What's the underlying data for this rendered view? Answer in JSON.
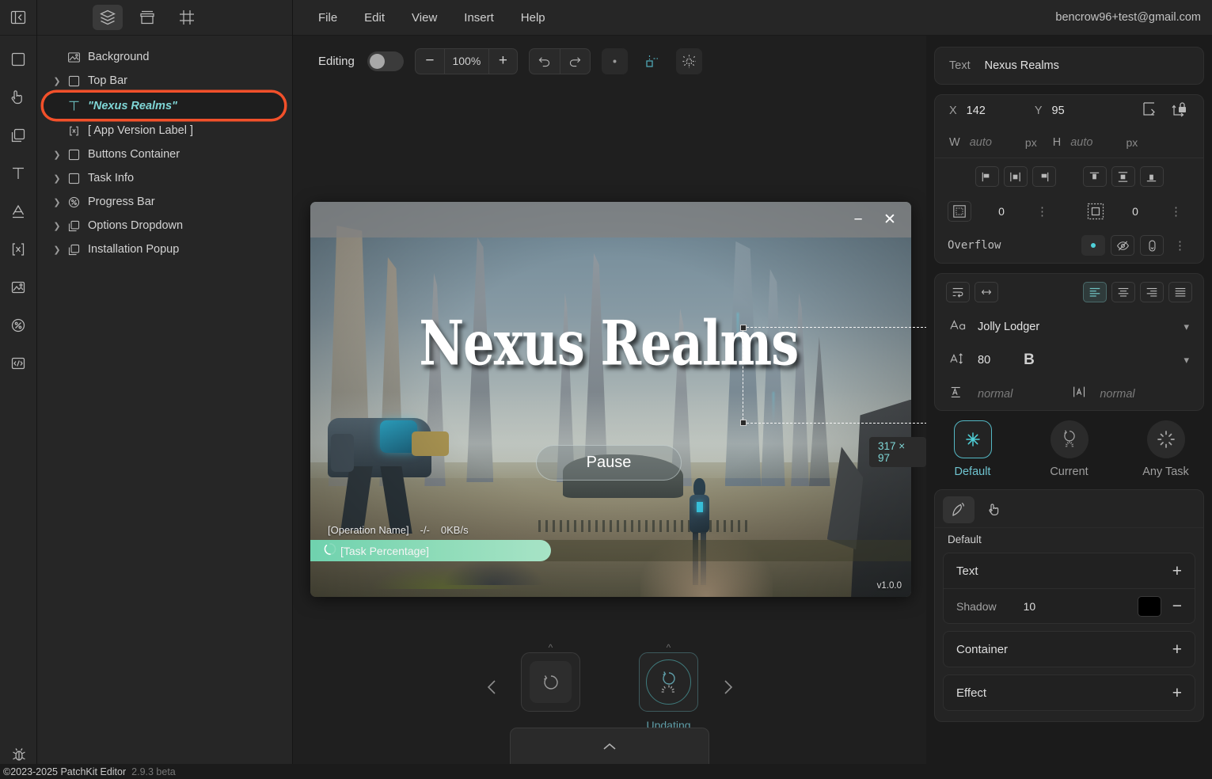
{
  "colors": {
    "accent_teal": "#7fd6d6",
    "selection_outline": "#f2502a",
    "panel_bg": "#262626",
    "canvas_bg": "#1f1f1f",
    "props_bg": "#1b1b1b",
    "progress_green": "#8fdcb9",
    "shadow_swatch": "#000000"
  },
  "rail": {
    "collapse_icon": "collapse-panel-icon",
    "tools": [
      {
        "name": "rectangle-tool-icon"
      },
      {
        "name": "button-tool-icon"
      },
      {
        "name": "panel-tool-icon"
      },
      {
        "name": "text-tool-icon"
      },
      {
        "name": "font-tool-icon"
      },
      {
        "name": "variable-tool-icon"
      },
      {
        "name": "image-tool-icon"
      },
      {
        "name": "progress-tool-icon"
      },
      {
        "name": "code-tool-icon"
      }
    ],
    "debug_icon": "bug-icon"
  },
  "layers_panel": {
    "tabs": [
      {
        "name": "layers-tab",
        "icon": "layers-icon",
        "active": true
      },
      {
        "name": "assets-tab",
        "icon": "box-icon",
        "active": false
      },
      {
        "name": "frames-tab",
        "icon": "frame-icon",
        "active": false
      }
    ],
    "items": [
      {
        "label": "Background",
        "icon": "image-icon",
        "expandable": false,
        "selected": false
      },
      {
        "label": "Top Bar",
        "icon": "square-icon",
        "expandable": true,
        "selected": false
      },
      {
        "label": "\"Nexus Realms\"",
        "icon": "text-icon",
        "expandable": false,
        "selected": true
      },
      {
        "label": "[ App Version Label ]",
        "icon": "variable-icon",
        "expandable": false,
        "selected": false
      },
      {
        "label": "Buttons Container",
        "icon": "square-icon",
        "expandable": true,
        "selected": false
      },
      {
        "label": "Task Info",
        "icon": "square-icon",
        "expandable": true,
        "selected": false
      },
      {
        "label": "Progress Bar",
        "icon": "percent-icon",
        "expandable": true,
        "selected": false
      },
      {
        "label": "Options Dropdown",
        "icon": "panel-icon",
        "expandable": true,
        "selected": false
      },
      {
        "label": "Installation Popup",
        "icon": "panel-icon",
        "expandable": true,
        "selected": false
      }
    ]
  },
  "menubar": {
    "items": [
      "File",
      "Edit",
      "View",
      "Insert",
      "Help"
    ],
    "account_email": "bencrow96+test@gmail.com"
  },
  "canvas_toolbar": {
    "editing_label": "Editing",
    "editing_toggle_on": false,
    "zoom_out_label": "−",
    "zoom_value": "100%",
    "zoom_in_label": "+",
    "undo_icon": "undo-icon",
    "redo_icon": "redo-icon",
    "point_snap_icon": "point-snap-icon",
    "object_snap_icon": "object-snap-icon",
    "grid_snap_icon": "grid-snap-icon"
  },
  "preview": {
    "window_minimize": "−",
    "window_close": "✕",
    "game_title": "Nexus Realms",
    "selection_size_badge": "317 × 97",
    "pause_button": "Pause",
    "operation_name": "[Operation Name]",
    "operation_progress": "-/-",
    "operation_speed": "0KB/s",
    "task_percentage_label": "[Task Percentage]",
    "version_label": "v1.0.0"
  },
  "carousel": {
    "prev_icon": "chevron-left-icon",
    "next_icon": "chevron-right-icon",
    "cards": [
      {
        "label": "",
        "icon": "refresh-icon",
        "active": false
      },
      {
        "label": "Updating",
        "icon": "updating-icon",
        "active": true
      }
    ],
    "drawer_icon": "chevron-up-icon"
  },
  "properties": {
    "text_field": {
      "label": "Text",
      "value": "Nexus Realms"
    },
    "transform": {
      "x_label": "X",
      "x_value": "142",
      "y_label": "Y",
      "y_value": "95",
      "w_label": "W",
      "w_placeholder": "auto",
      "w_unit": "px",
      "h_label": "H",
      "h_placeholder": "auto",
      "h_unit": "px",
      "corner_icon": "anchor-corner-icon",
      "lock_icon": "lock-aspect-icon"
    },
    "align": {
      "horizontal": [
        {
          "name": "align-left-icon",
          "active": false
        },
        {
          "name": "align-center-h-icon",
          "active": false
        },
        {
          "name": "align-right-icon",
          "active": false
        }
      ],
      "vertical": [
        {
          "name": "align-top-icon",
          "active": false
        },
        {
          "name": "align-middle-v-icon",
          "active": false
        },
        {
          "name": "align-bottom-icon",
          "active": false
        }
      ]
    },
    "spacing": {
      "margin_icon": "margin-icon",
      "margin_value": "0",
      "padding_icon": "padding-icon",
      "padding_value": "0"
    },
    "overflow": {
      "label": "Overflow",
      "visible_icon": "dot-icon",
      "hidden_icon": "eye-off-icon",
      "scroll_icon": "scroll-icon"
    },
    "text_style": {
      "wrap_icon": "text-wrap-icon",
      "nowrap_icon": "text-nowrap-icon",
      "align_options": [
        {
          "name": "text-align-left-icon",
          "active": true
        },
        {
          "name": "text-align-center-icon",
          "active": false
        },
        {
          "name": "text-align-right-icon",
          "active": false
        },
        {
          "name": "text-align-justify-icon",
          "active": false
        }
      ],
      "font_icon": "font-family-icon",
      "font_family": "Jolly Lodger",
      "size_icon": "font-size-icon",
      "font_size": "80",
      "bold_label": "B",
      "line_height_icon": "line-height-icon",
      "line_height_placeholder": "normal",
      "letter_spacing_icon": "letter-spacing-icon",
      "letter_spacing_placeholder": "normal"
    },
    "states": [
      {
        "label": "Default",
        "icon": "asterisk-icon",
        "active": true,
        "shape": "box"
      },
      {
        "label": "Current",
        "icon": "current-task-icon",
        "active": false,
        "shape": "circle"
      },
      {
        "label": "Any Task",
        "icon": "any-task-icon",
        "active": false,
        "shape": "circle"
      }
    ],
    "style_tabs": [
      {
        "name": "style-brush-tab",
        "icon": "brush-icon",
        "active": true
      },
      {
        "name": "style-interaction-tab",
        "icon": "pointer-icon",
        "active": false
      }
    ],
    "style_state_label": "Default",
    "sections": [
      {
        "label": "Text",
        "add_label": "+",
        "rows": [
          {
            "label": "Shadow",
            "value": "10",
            "swatch": "#000000",
            "remove_label": "−"
          }
        ]
      },
      {
        "label": "Container",
        "add_label": "+",
        "rows": []
      },
      {
        "label": "Effect",
        "add_label": "+",
        "rows": []
      }
    ]
  },
  "status_bar": {
    "copyright": "©2023-2025 PatchKit Editor",
    "version": "2.9.3 beta"
  }
}
